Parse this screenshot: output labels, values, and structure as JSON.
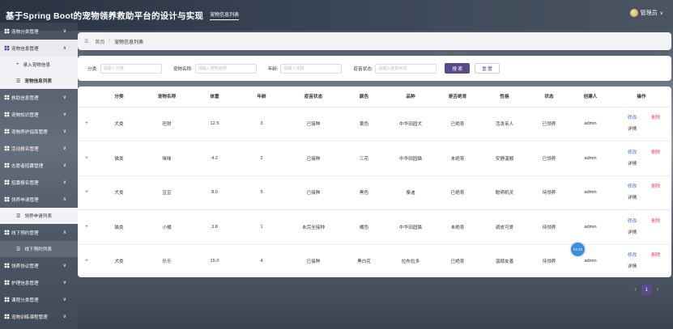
{
  "header": {
    "app_title": "基于Spring Boot的宠物领养救助平台的设计与实现",
    "active_tab": "宠物信息列表",
    "user_name": "管理员"
  },
  "sidebar": {
    "items": [
      {
        "label": "宠物分类管理",
        "caret": "∨",
        "active": false
      },
      {
        "label": "宠物信息管理",
        "caret": "∧",
        "active": true
      },
      {
        "label": "救助信息管理",
        "caret": "∨",
        "active": false
      },
      {
        "label": "宠物知识管理",
        "caret": "∨",
        "active": false
      },
      {
        "label": "宠物养护指南管理",
        "caret": "∨",
        "active": false
      },
      {
        "label": "活动报名管理",
        "caret": "∨",
        "active": false
      },
      {
        "label": "志愿者招募管理",
        "caret": "∨",
        "active": false
      },
      {
        "label": "招募报名管理",
        "caret": "∨",
        "active": false
      },
      {
        "label": "领养申请管理",
        "caret": "∧",
        "active": false
      },
      {
        "label": "线下预约管理",
        "caret": "∧",
        "active": false
      },
      {
        "label": "领养协议管理",
        "caret": "∨",
        "active": false
      },
      {
        "label": "护理信息管理",
        "caret": "∨",
        "active": false
      },
      {
        "label": "课程分类管理",
        "caret": "∨",
        "active": false
      },
      {
        "label": "宠物训练课程管理",
        "caret": "∨",
        "active": false
      }
    ],
    "sub_pet": [
      {
        "icon": "+",
        "label": "录入宠物信息"
      },
      {
        "icon": "☰",
        "label": "宠物信息列表"
      }
    ],
    "sub_adopt": [
      {
        "icon": "☰",
        "label": "领养申请列表"
      }
    ],
    "sub_visit": [
      {
        "icon": "☰",
        "label": "线下预约列表"
      }
    ]
  },
  "breadcrumb": {
    "home": "首页",
    "separator": "/",
    "current": "宠物信息列表"
  },
  "search": {
    "fields": [
      {
        "label": "分类:",
        "placeholder": "请输入分类"
      },
      {
        "label": "宠物名称:",
        "placeholder": "请输入宠物名称"
      },
      {
        "label": "年龄:",
        "placeholder": "请输入年龄"
      },
      {
        "label": "疫苗状态:",
        "placeholder": "请输入疫苗状态"
      }
    ],
    "search_label": "搜 索",
    "reset_label": "重 置"
  },
  "table": {
    "columns": [
      "",
      "分类",
      "宠物名称",
      "体重",
      "年龄",
      "疫苗状态",
      "颜色",
      "品种",
      "是否绝育",
      "性格",
      "状态",
      "创建人",
      "操作"
    ],
    "expand_symbol": "+",
    "edit_label": "修改",
    "delete_label": "删除",
    "detail_label": "详情",
    "rows": [
      [
        "犬类",
        "旺财",
        "12.5",
        "3",
        "已接种",
        "黄色",
        "中华田园犬",
        "已绝育",
        "活泼亲人",
        "已领养",
        "admin"
      ],
      [
        "猫类",
        "咪咪",
        "4.2",
        "2",
        "已接种",
        "三花",
        "中华田园猫",
        "未绝育",
        "安静温顺",
        "已领养",
        "admin"
      ],
      [
        "犬类",
        "豆豆",
        "8.0",
        "5",
        "已接种",
        "黑色",
        "泰迪",
        "已绝育",
        "聪明机灵",
        "待领养",
        "admin"
      ],
      [
        "猫类",
        "小橘",
        "3.8",
        "1",
        "未完全接种",
        "橘色",
        "中华田园猫",
        "未绝育",
        "调皮可爱",
        "待领养",
        "admin"
      ],
      [
        "犬类",
        "乐乐",
        "15.0",
        "4",
        "已接种",
        "黑白花",
        "拉布拉多",
        "已绝育",
        "温顺友善",
        "待领养",
        "admin"
      ]
    ]
  },
  "pagination": {
    "prev": "‹",
    "current_page": "1",
    "next": "›"
  },
  "float_badge": "04:40",
  "colors": {
    "accent": "#5b4a8b",
    "edit_link": "#3a6fd8",
    "delete_link": "#e0485c"
  }
}
